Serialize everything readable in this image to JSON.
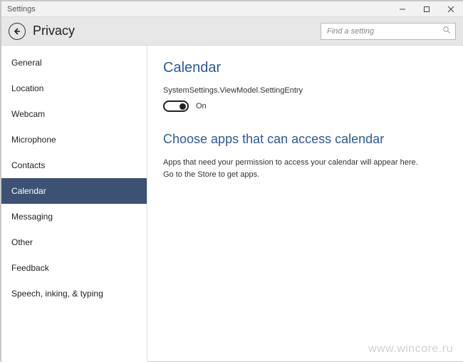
{
  "window": {
    "title": "Settings"
  },
  "header": {
    "page_title": "Privacy",
    "search_placeholder": "Find a setting"
  },
  "sidebar": {
    "items": [
      {
        "label": "General"
      },
      {
        "label": "Location"
      },
      {
        "label": "Webcam"
      },
      {
        "label": "Microphone"
      },
      {
        "label": "Contacts"
      },
      {
        "label": "Calendar"
      },
      {
        "label": "Messaging"
      },
      {
        "label": "Other"
      },
      {
        "label": "Feedback"
      },
      {
        "label": "Speech, inking, & typing"
      }
    ],
    "active_index": 5
  },
  "main": {
    "heading": "Calendar",
    "setting_entry": "SystemSettings.ViewModel.SettingEntry",
    "toggle_state": "On",
    "subheading": "Choose apps that can access calendar",
    "description": "Apps that need your permission to access your calendar will appear here. Go to the Store to get apps."
  },
  "watermark": "www.wincore.ru"
}
